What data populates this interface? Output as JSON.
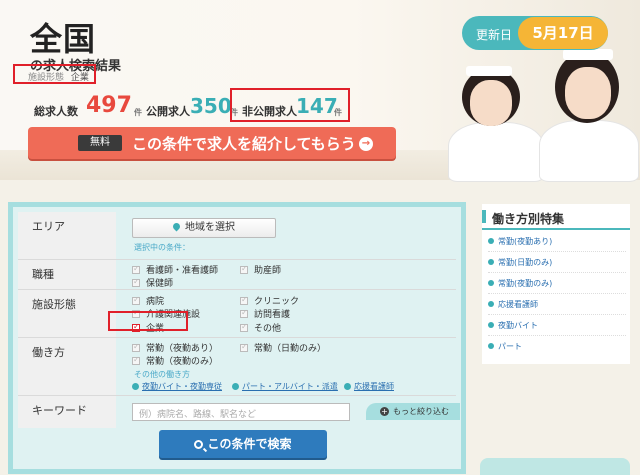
{
  "hero": {
    "title": "全国",
    "subtitle": "の求人検索結果",
    "condition_key": "施設形態",
    "condition_value": "企業",
    "total_label": "総求人数",
    "total_count": "497",
    "public_label": "公開求人",
    "public_count": "350",
    "private_label": "非公開求人",
    "private_count": "147",
    "unit": "件",
    "update_label": "更新日",
    "update_date": "5月17日",
    "cta_badge": "無料",
    "cta_text": "この条件で求人を紹介してもらう"
  },
  "search": {
    "area_label": "エリア",
    "area_button": "地域を選択",
    "selected_conditions": "選択中の条件：",
    "job_label": "職種",
    "jobs": [
      "看護師・准看護師",
      "助産師",
      "保健師"
    ],
    "facility_label": "施設形態",
    "facilities": [
      "病院",
      "クリニック",
      "介護関連施設",
      "訪問看護",
      "企業",
      "その他"
    ],
    "work_label": "働き方",
    "works": [
      "常勤（夜勤あり）",
      "常勤（日勤のみ）",
      "常勤（夜勤のみ）"
    ],
    "other_work_label": "その他の働き方",
    "other_links": [
      "夜勤バイト・夜勤専従",
      "パート・アルバイト・派遣",
      "応援看護師"
    ],
    "keyword_label": "キーワード",
    "keyword_placeholder": "例）病院名、路線、駅名など",
    "more_label": "もっと絞り込む",
    "search_button": "この条件で検索"
  },
  "sidebar": {
    "title": "働き方別特集",
    "items": [
      "常勤(夜勤あり)",
      "常勤(日勤のみ)",
      "常勤(夜勤のみ)",
      "応援看護師",
      "夜勤バイト",
      "パート"
    ]
  },
  "colors": {
    "accent_red": "#e8493e",
    "accent_teal": "#3aaeb5",
    "cta": "#ef6b57",
    "search_button": "#2e7bbd",
    "date_badge": "#f5b536"
  }
}
